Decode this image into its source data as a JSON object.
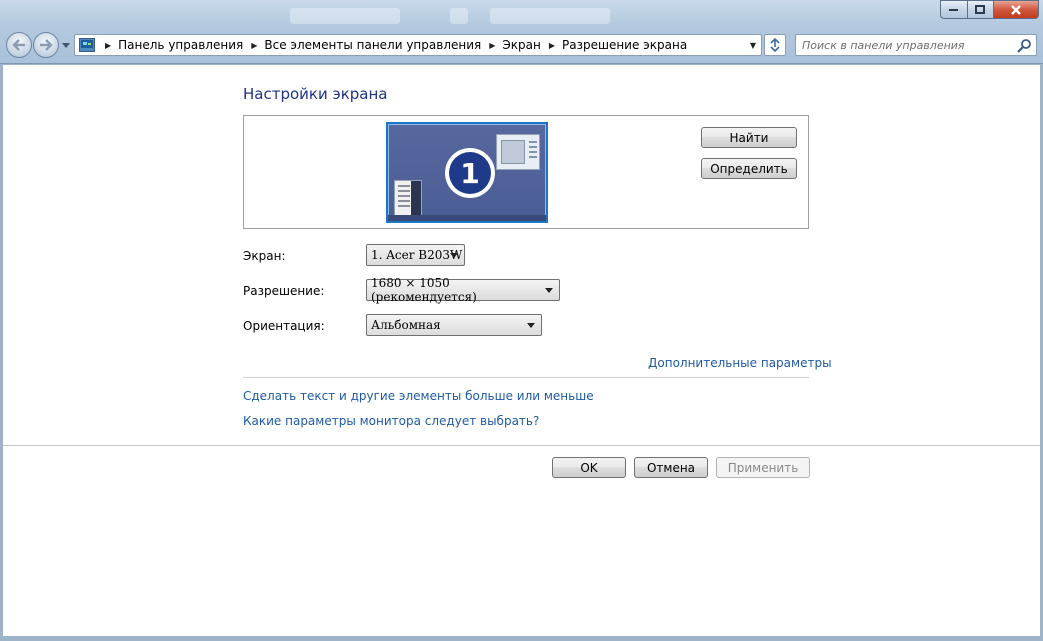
{
  "breadcrumbs": [
    "Панель управления",
    "Все элементы панели управления",
    "Экран",
    "Разрешение экрана"
  ],
  "search": {
    "placeholder": "Поиск в панели управления"
  },
  "page": {
    "title": "Настройки экрана"
  },
  "preview": {
    "monitor_number": "1",
    "find_label": "Найти",
    "identify_label": "Определить"
  },
  "form": {
    "screen_label": "Экран:",
    "screen_value": "1. Acer B203W",
    "resolution_label": "Разрешение:",
    "resolution_value": "1680 × 1050 (рекомендуется)",
    "orientation_label": "Ориентация:",
    "orientation_value": "Альбомная"
  },
  "links": {
    "advanced": "Дополнительные параметры",
    "text_size": "Сделать текст и другие элементы больше или меньше",
    "monitor_help": "Какие параметры монитора следует выбрать?"
  },
  "buttons": {
    "ok": "OK",
    "cancel": "Отмена",
    "apply": "Применить"
  },
  "colors": {
    "title": "#1e3287",
    "link": "#1e5aa8",
    "monitor_bg": "#4b5d95"
  }
}
